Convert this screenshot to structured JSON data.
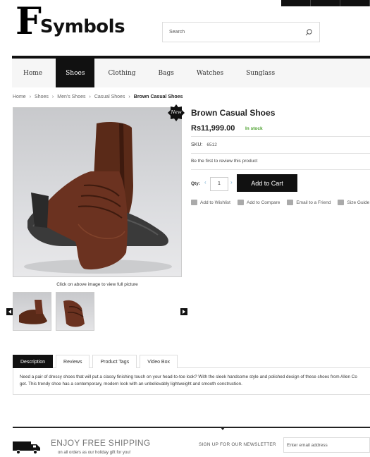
{
  "brand": {
    "letter": "F",
    "name": "Symbols"
  },
  "search": {
    "placeholder": "Search"
  },
  "nav": {
    "items": [
      "Home",
      "Shoes",
      "Clothing",
      "Bags",
      "Watches",
      "Sunglass"
    ],
    "active": "Shoes"
  },
  "breadcrumb": [
    "Home",
    "Shoes",
    "Men's Shoes",
    "Casual Shoes",
    "Brown Casual Shoes"
  ],
  "product": {
    "badge": "New",
    "title": "Brown Casual Shoes",
    "price": "Rs11,999.00",
    "stock": "In stock",
    "sku_label": "SKU:",
    "sku_value": "6512",
    "review_text": "Be the first to review this product",
    "qty_label": "Qty:",
    "qty_value": "1",
    "add_to_cart": "Add to Cart",
    "image_caption": "Click on above image to view full picture"
  },
  "actions": [
    "Add to Wishlist",
    "Add to Compare",
    "Email to a Friend",
    "Size Guide"
  ],
  "tabs": [
    "Description",
    "Reviews",
    "Product Tags",
    "Video Box"
  ],
  "description": {
    "line1": "Need a pair of dressy shoes that will put a classy finishing touch on your head-to-toe look? With the sleek handsome style and polished design of these shoes from Allen Co",
    "line2": "get. This trendy shoe has a contemporary, modern look with an unbelievably lightweight and smooth construction."
  },
  "footer": {
    "shipping_title": "ENJOY FREE SHIPPING",
    "shipping_sub": "on all orders as our holiday gift for you!",
    "newsletter_label": "SIGN UP FOR OUR NEWSLETTER",
    "email_placeholder": "Enter email address"
  },
  "colors": {
    "accent": "#111111",
    "stock": "#4aa02c",
    "link_arrows": "#7fb3d5"
  }
}
